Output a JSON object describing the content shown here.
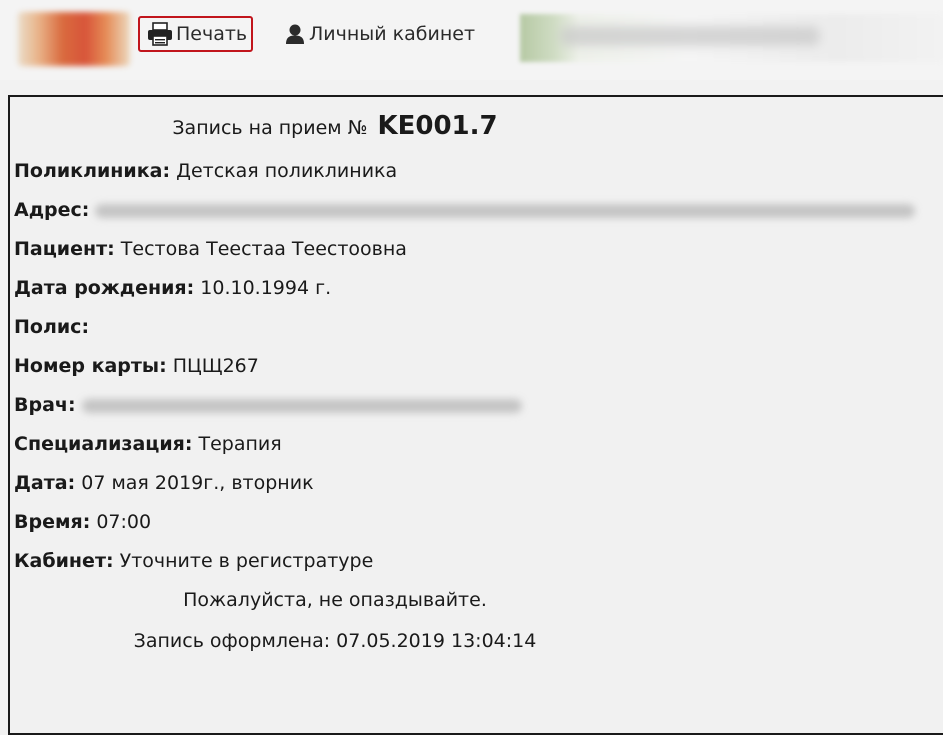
{
  "toolbar": {
    "print_label": "Печать",
    "cabinet_label": "Личный кабинет",
    "print_highlight_color": "#c1151c"
  },
  "appointment": {
    "title_prefix": "Запись на прием №",
    "number": "KE001.7",
    "fields": [
      {
        "key": "Поликлиника:",
        "value": "Детская поликлиника"
      },
      {
        "key": "Адрес:",
        "value": ""
      },
      {
        "key": "Пациент:",
        "value": "Тестова Теестаа Теестоовна"
      },
      {
        "key": "Дата рождения:",
        "value": "10.10.1994 г."
      },
      {
        "key": "Полис:",
        "value": ""
      },
      {
        "key": "Номер карты:",
        "value": "ПЦЩ267"
      },
      {
        "key": "Врач:",
        "value": ""
      },
      {
        "key": "Специализация:",
        "value": "Терапия"
      },
      {
        "key": "Дата:",
        "value": "07 мая 2019г., вторник"
      },
      {
        "key": "Время:",
        "value": "07:00"
      },
      {
        "key": "Кабинет:",
        "value": "Уточните в регистратуре"
      }
    ],
    "reminder": "Пожалуйста, не опаздывайте.",
    "created": "Запись оформлена: 07.05.2019 13:04:14"
  },
  "icons": {
    "print": "printer-icon",
    "user": "user-icon"
  }
}
